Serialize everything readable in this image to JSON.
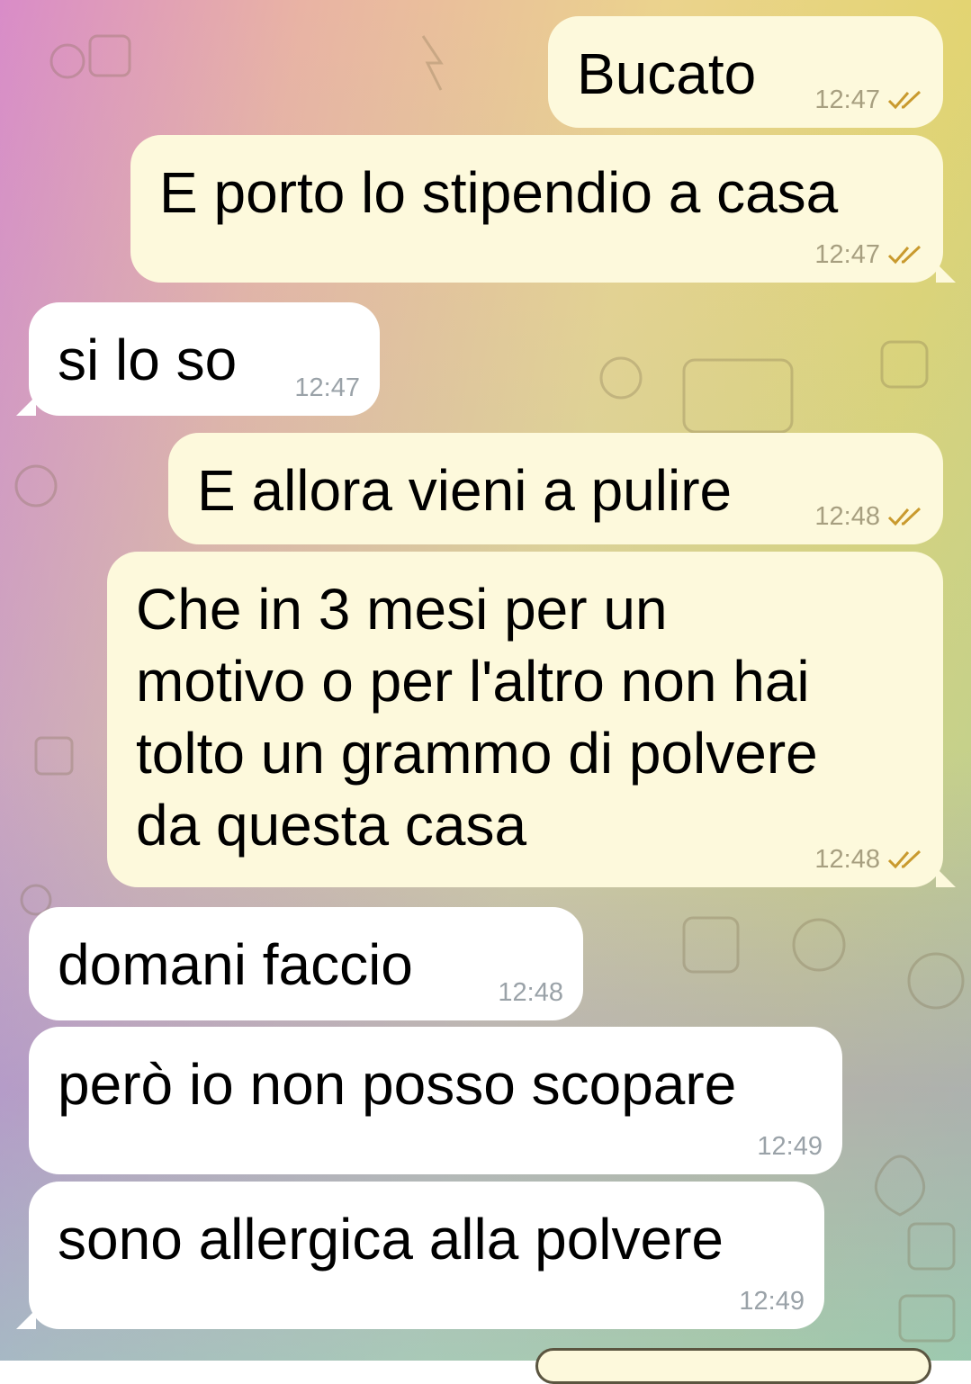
{
  "chat": {
    "messages": [
      {
        "text": "Bucato",
        "time": "12:47"
      },
      {
        "text": "E porto lo stipendio a casa",
        "time": "12:47"
      },
      {
        "text": "si lo so",
        "time": "12:47"
      },
      {
        "text": "E allora vieni a pulire",
        "time": "12:48"
      },
      {
        "text": "Che in 3 mesi per un\nmotivo o per l'altro non hai\ntolto un grammo di polvere\nda questa casa",
        "time": "12:48"
      },
      {
        "text": "domani faccio",
        "time": "12:48"
      },
      {
        "text": "però io non posso scopare",
        "time": "12:49"
      },
      {
        "text": "sono allergica alla polvere",
        "time": "12:49"
      }
    ]
  },
  "icons": {
    "read_receipt": "double-check-icon"
  },
  "colors": {
    "outgoing_bubble": "#fdf9dc",
    "incoming_bubble": "#ffffff",
    "check": "#c99a2e"
  }
}
